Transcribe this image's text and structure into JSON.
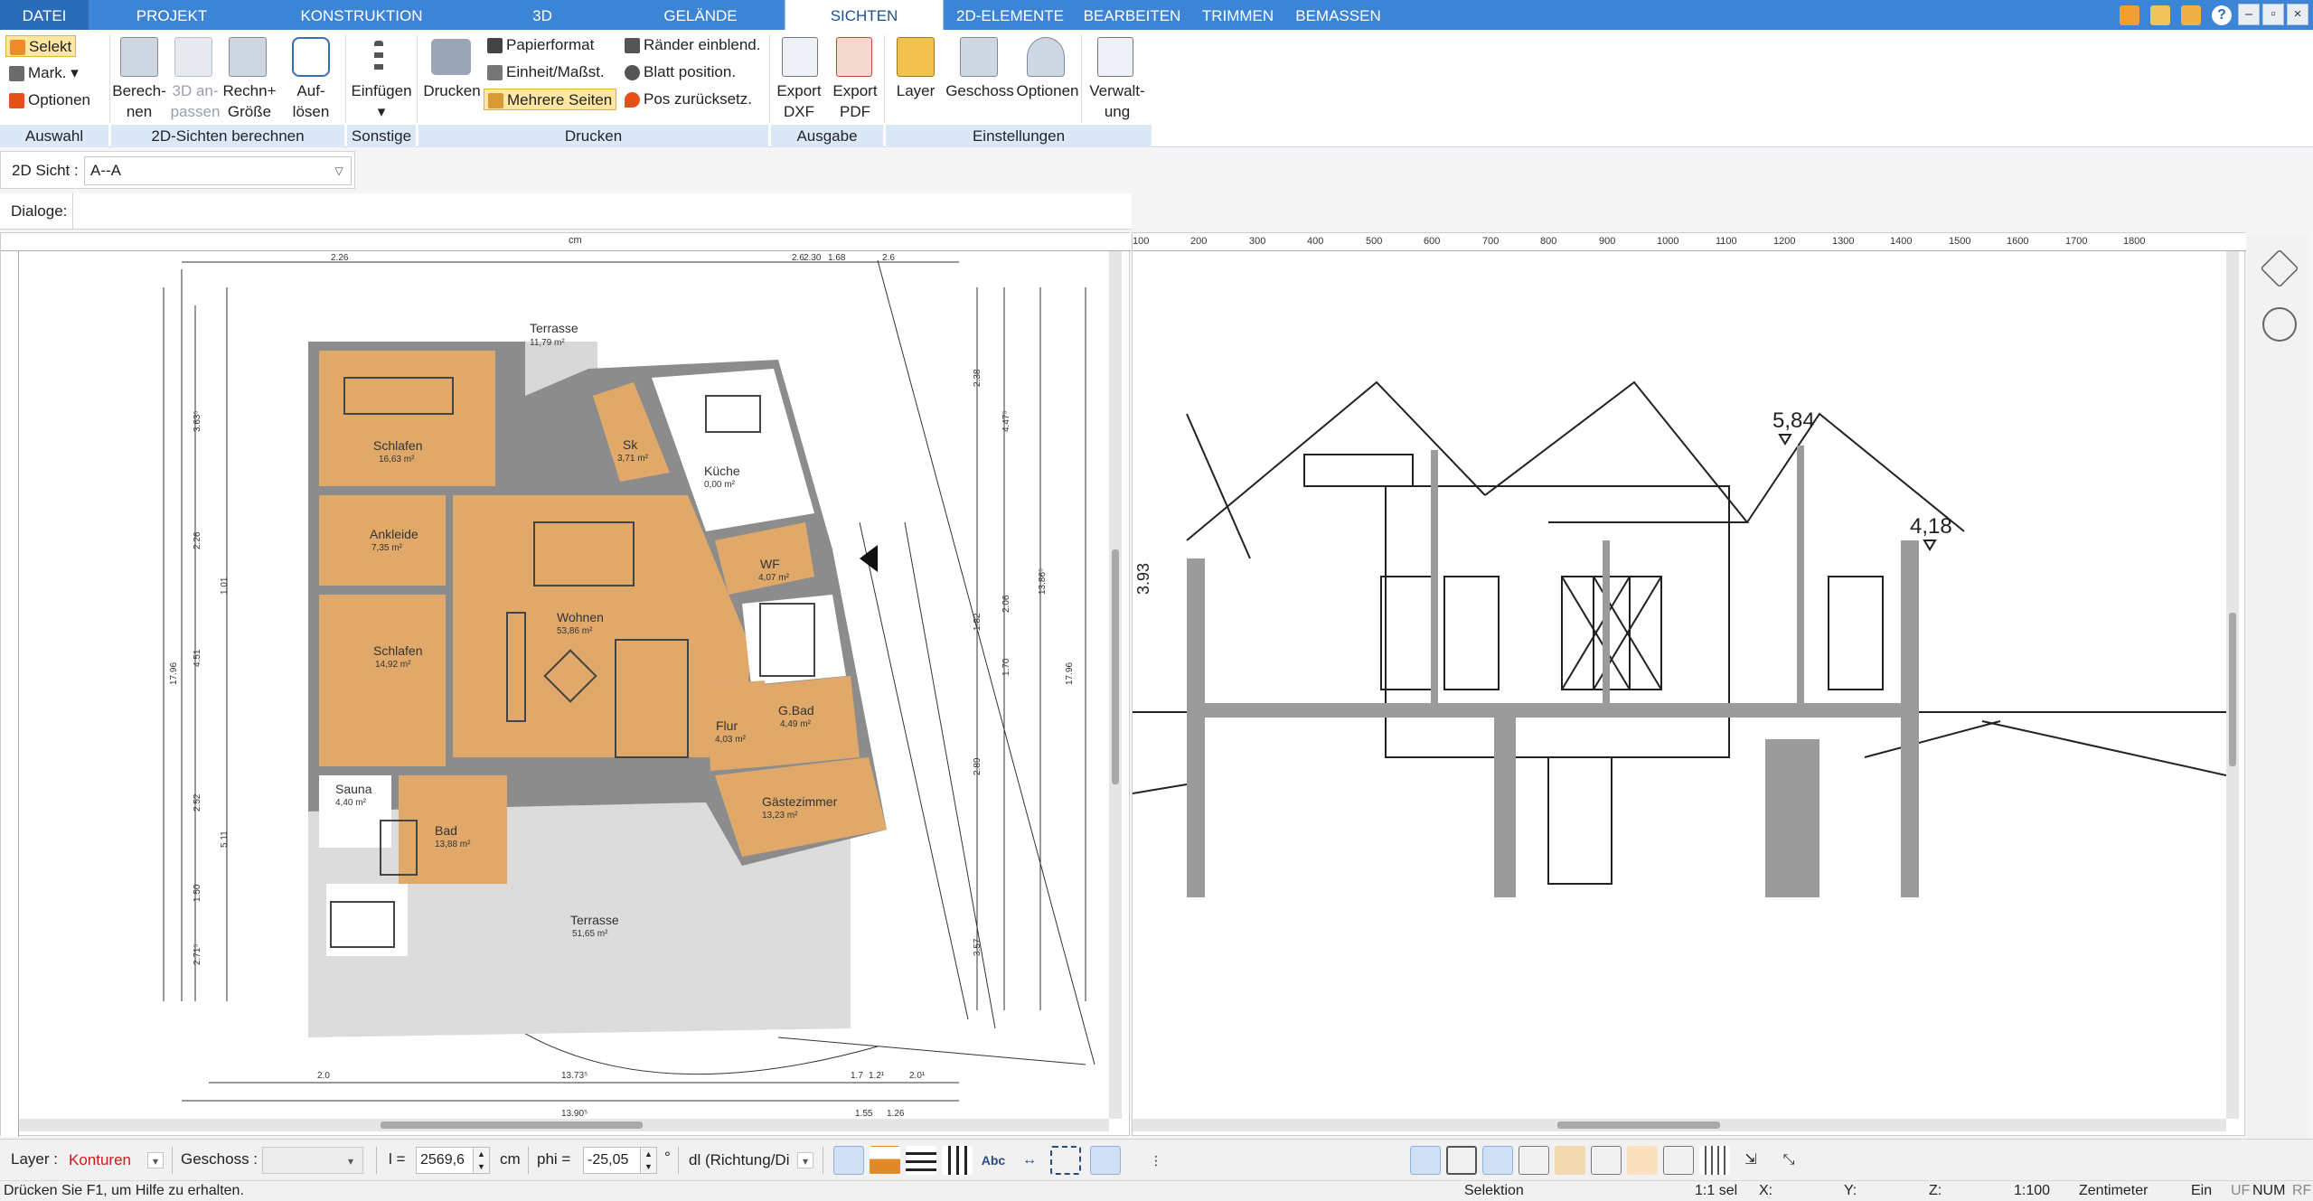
{
  "menubar": {
    "tabs": [
      "DATEI",
      "PROJEKT",
      "KONSTRUKTION",
      "3D",
      "GELÄNDE",
      "SICHTEN",
      "2D-ELEMENTE",
      "BEARBEITEN",
      "TRIMMEN",
      "BEMASSEN"
    ],
    "active_tab": "SICHTEN"
  },
  "ribbon": {
    "auswahl": {
      "select": "Selekt",
      "mark": "Mark.",
      "options": "Optionen",
      "group": "Auswahl"
    },
    "sichten2d": {
      "calc": "Berech-\nnen",
      "adjust": "3D an-\npassen",
      "calc_size": "Rechn+\nGröße",
      "group": "2D-Sichten berechnen"
    },
    "resolve": {
      "label": "Auf-\nlösen"
    },
    "sonstige": {
      "insert": "Einfügen",
      "group": "Sonstige"
    },
    "drucken": {
      "print": "Drucken",
      "paper": "Papierformat",
      "unit": "Einheit/Maßst.",
      "multi": "Mehrere Seiten",
      "margins": "Ränder einblend.",
      "sheet": "Blatt position.",
      "reset": "Pos zurücksetz.",
      "group": "Drucken"
    },
    "ausgabe": {
      "dxf": "Export\nDXF",
      "pdf": "Export\nPDF",
      "group": "Ausgabe"
    },
    "einstellungen": {
      "layer": "Layer",
      "storey": "Geschoss",
      "options": "Optionen",
      "group": "Einstellungen"
    },
    "admin": {
      "label": "Verwalt-\nung"
    }
  },
  "view": {
    "label": "2D Sicht :",
    "value": "A--A"
  },
  "dialogs": {
    "label": "Dialoge:"
  },
  "plan": {
    "ruler_unit": "cm",
    "rooms": [
      {
        "name": "Terrasse",
        "area": "11,79 m²"
      },
      {
        "name": "Schlafen",
        "area": "16,63 m²"
      },
      {
        "name": "Sk",
        "area": "3,71 m²"
      },
      {
        "name": "Küche",
        "area": "0,00 m²"
      },
      {
        "name": "Ankleide",
        "area": "7,35 m²"
      },
      {
        "name": "WF",
        "area": "4,07 m²"
      },
      {
        "name": "Wohnen",
        "area": "53,86 m²"
      },
      {
        "name": "Schlafen",
        "area": "14,92 m²"
      },
      {
        "name": "G.Bad",
        "area": "4,49 m²"
      },
      {
        "name": "Flur",
        "area": "4,03 m²"
      },
      {
        "name": "Sauna",
        "area": "4,40 m²"
      },
      {
        "name": "Bad",
        "area": "13,88 m²"
      },
      {
        "name": "Gästezimmer",
        "area": "13,23 m²"
      },
      {
        "name": "Terrasse",
        "area": "51,65 m²"
      }
    ],
    "dims_top": [
      "2.26",
      "2.6",
      "2.30",
      "1.68",
      "2.6"
    ],
    "dims_bottom": [
      "13.73⁵",
      "1.2¹",
      "1.7",
      "13.90⁵",
      "2.0¹",
      "2.0",
      "1.55",
      "1.26"
    ],
    "dims_left": [
      "17.96",
      "5.11",
      "4.51",
      "3.63⁵",
      "2.52",
      "2.71⁵",
      "1.50",
      "2.26",
      "1.01"
    ],
    "dims_right": [
      "17.96",
      "13.86⁵",
      "4.47⁵",
      "2.38",
      "2.89",
      "3.57",
      "1.70",
      "2.06",
      "1.82"
    ]
  },
  "section": {
    "ruler_ticks": [
      "100",
      "200",
      "300",
      "400",
      "500",
      "600",
      "700",
      "800",
      "900",
      "1000",
      "1100",
      "1200",
      "1300",
      "1400",
      "1500",
      "1600",
      "1700",
      "1800"
    ],
    "heights": [
      "5,84",
      "4,18",
      "3.93"
    ]
  },
  "toolbar": {
    "layer_label": "Layer :",
    "layer_value": "Konturen",
    "storey_label": "Geschoss :",
    "length_label": "l =",
    "length_value": "2569,6",
    "length_unit": "cm",
    "phi_label": "phi =",
    "phi_value": "-25,05",
    "phi_unit": "°",
    "direction_value": "dl (Richtung/Di"
  },
  "status": {
    "help": "Drücken Sie F1, um Hilfe zu erhalten.",
    "mode": "Selektion",
    "scale_sel": "1:1 sel",
    "x": "X:",
    "y": "Y:",
    "z": "Z:",
    "scale": "1:100",
    "unit": "Zentimeter",
    "insert": "Ein",
    "uf": "UF",
    "num": "NUM",
    "rf": "RF"
  },
  "colors": {
    "accent": "#3c84d6",
    "floor": "#e0a96a",
    "wall": "#8c8c8c",
    "terrace": "#d8d8d8",
    "highlight": "#ffe7a2"
  }
}
